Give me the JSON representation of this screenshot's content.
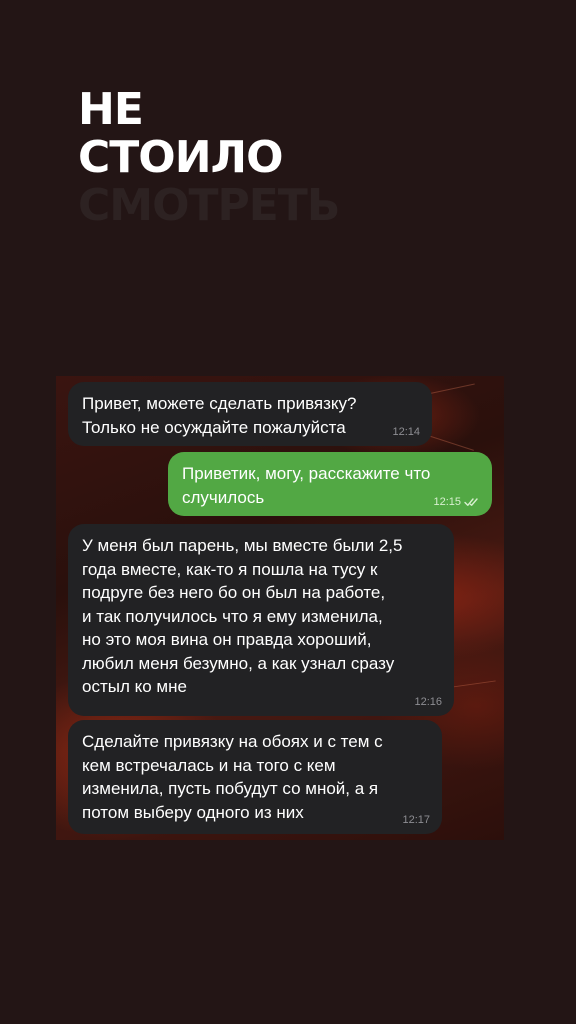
{
  "headline": {
    "line1": "НЕ",
    "line2": "СТОИЛО",
    "line3": "СМОТРЕТЬ"
  },
  "chat": {
    "messages": [
      {
        "direction": "in",
        "text": "Привет, можете сделать привязку?\nТолько не осуждайте пожалуйста",
        "time": "12:14"
      },
      {
        "direction": "out",
        "text": "Приветик, могу, расскажите что\nслучилось",
        "time": "12:15",
        "status_icon": "double-check-icon"
      },
      {
        "direction": "in",
        "text": "У меня был парень, мы вместе были 2,5\nгода вместе,  как-то я пошла на тусу к\nподруге без него бо он был на работе,\nи так получилось что я ему изменила,\nно это моя вина он правда хороший,\nлюбил меня безумно, а как узнал сразу\nостыл ко мне",
        "time": "12:16"
      },
      {
        "direction": "in",
        "text": "Сделайте привязку на обоях и с тем с\nкем встречалась и на того с кем\nизменила, пусть побудут со мной, а я\nпотом выберу одного из них",
        "time": "12:17"
      }
    ]
  },
  "colors": {
    "background": "#231515",
    "incoming_bubble": "#222224",
    "outgoing_bubble": "#52a844"
  }
}
